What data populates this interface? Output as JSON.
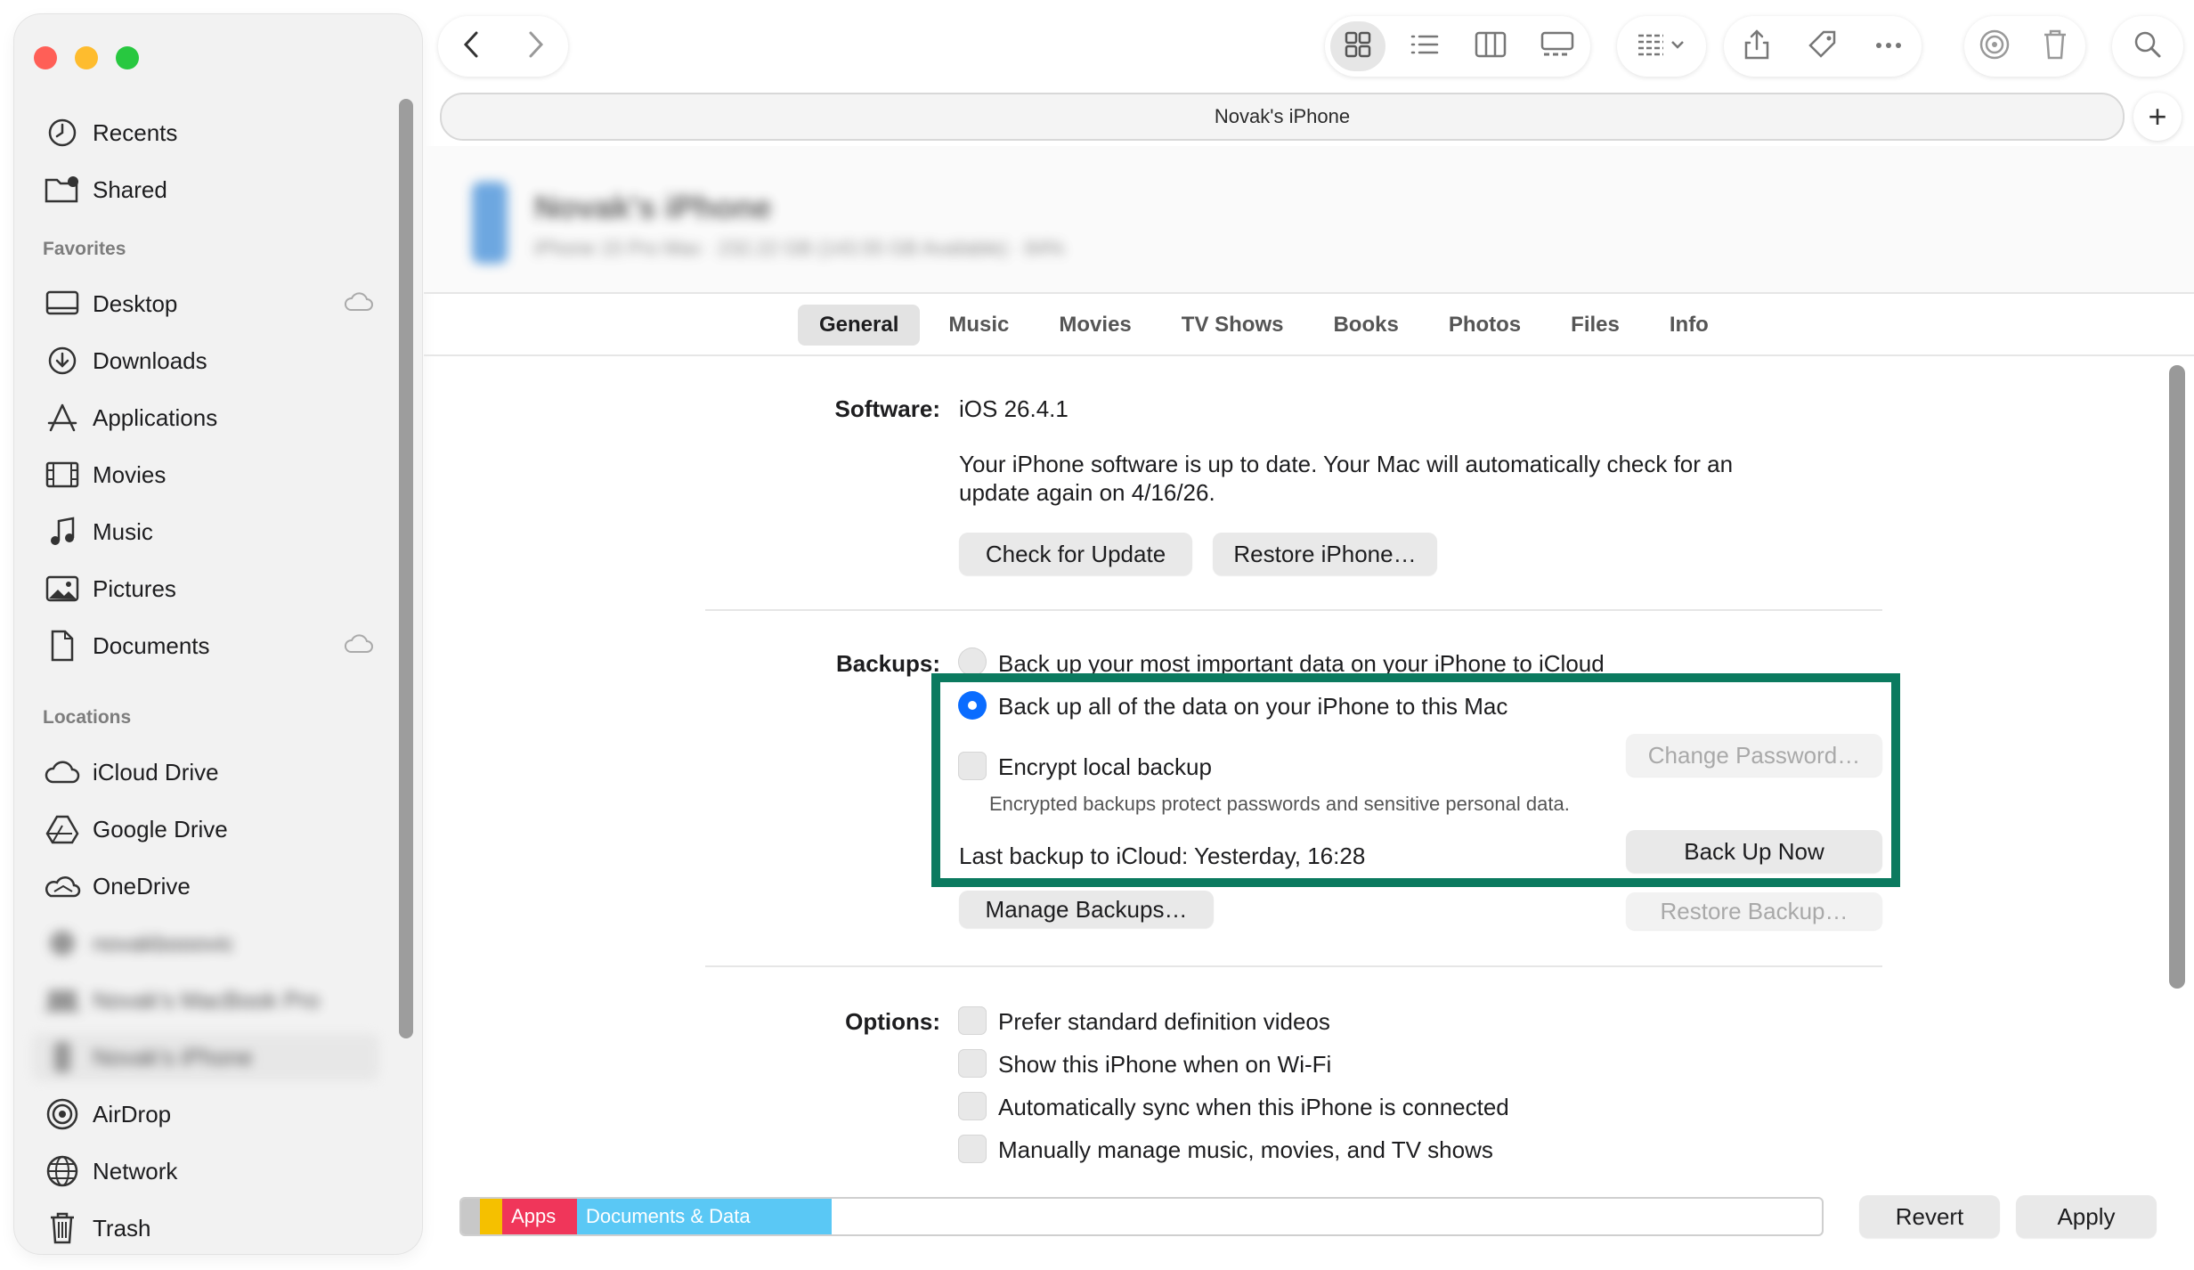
{
  "window_title": "Novak's iPhone",
  "sidebar": {
    "top_items": [
      {
        "label": "Recents",
        "icon": "clock-icon"
      },
      {
        "label": "Shared",
        "icon": "shared-folder-icon"
      }
    ],
    "favorites_heading": "Favorites",
    "favorites": [
      {
        "label": "Desktop",
        "icon": "desktop-icon"
      },
      {
        "label": "Downloads",
        "icon": "download-icon"
      },
      {
        "label": "Applications",
        "icon": "applications-icon"
      },
      {
        "label": "Movies",
        "icon": "film-icon"
      },
      {
        "label": "Music",
        "icon": "music-note-icon"
      },
      {
        "label": "Pictures",
        "icon": "photo-icon"
      },
      {
        "label": "Documents",
        "icon": "document-icon"
      }
    ],
    "locations_heading": "Locations",
    "locations": [
      {
        "label": "iCloud Drive",
        "icon": "cloud-icon"
      },
      {
        "label": "Google Drive",
        "icon": "google-drive-icon"
      },
      {
        "label": "OneDrive",
        "icon": "onedrive-icon"
      },
      {
        "label": "novakbooovic",
        "icon": "disk-icon"
      },
      {
        "label": "Novak's MacBook Pro",
        "icon": "laptop-icon"
      },
      {
        "label": "Novak's iPhone",
        "icon": "iphone-icon"
      },
      {
        "label": "AirDrop",
        "icon": "airdrop-icon"
      },
      {
        "label": "Network",
        "icon": "globe-icon"
      },
      {
        "label": "Trash",
        "icon": "trash-icon"
      }
    ]
  },
  "device": {
    "name": "Novak's iPhone",
    "subtitle": "iPhone 15 Pro Max · 232.22 GB (143.55 GB Available) · 84%"
  },
  "tabs": [
    "General",
    "Music",
    "Movies",
    "TV Shows",
    "Books",
    "Photos",
    "Files",
    "Info"
  ],
  "software": {
    "label": "Software:",
    "version": "iOS 26.4.1",
    "status_line1": "Your iPhone software is up to date. Your Mac will automatically check for an",
    "status_line2": "update again on 4/16/26.",
    "check_button": "Check for Update",
    "restore_button": "Restore iPhone…"
  },
  "backups": {
    "label": "Backups:",
    "option_icloud": "Back up your most important data on your iPhone to iCloud",
    "option_mac": "Back up all of the data on your iPhone to this Mac",
    "encrypt_label": "Encrypt local backup",
    "encrypt_note": "Encrypted backups protect passwords and sensitive personal data.",
    "change_password_button": "Change Password…",
    "last_backup": "Last backup to iCloud:  Yesterday, 16:28",
    "backup_now_button": "Back Up Now",
    "manage_button": "Manage Backups…",
    "restore_backup_button": "Restore Backup…"
  },
  "options": {
    "label": "Options:",
    "items": [
      "Prefer standard definition videos",
      "Show this iPhone when on Wi-Fi",
      "Automatically sync when this iPhone is connected",
      "Manually manage music, movies, and TV shows"
    ]
  },
  "storage_bar": {
    "segments": [
      {
        "label": "",
        "color": "#c8c8c8",
        "fraction": 0.0138
      },
      {
        "label": "",
        "color": "#f5c000",
        "fraction": 0.0164
      },
      {
        "label": "Apps",
        "color": "#f0365a",
        "fraction": 0.0549
      },
      {
        "label": "Documents & Data",
        "color": "#5ac8f5",
        "fraction": 0.1873
      }
    ]
  },
  "footer": {
    "revert_button": "Revert",
    "apply_button": "Apply"
  },
  "colors": {
    "accent": "#0a6cff",
    "highlight_border": "#0b7a5f"
  }
}
